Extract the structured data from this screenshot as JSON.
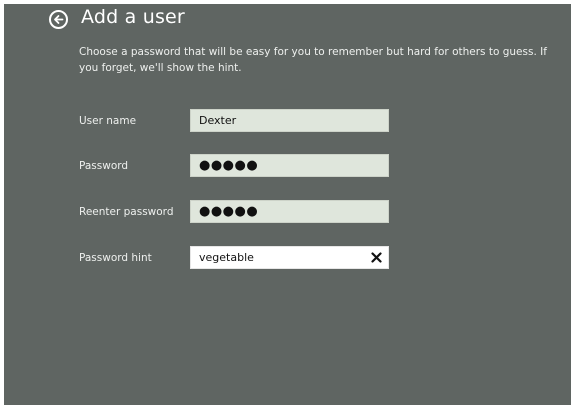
{
  "page": {
    "title": "Add a user",
    "description": "Choose a password that will be easy for you to remember but hard for others to guess. If you forget, we'll show the hint."
  },
  "form": {
    "username": {
      "label": "User name",
      "value": "Dexter"
    },
    "password": {
      "label": "Password",
      "value": "●●●●●"
    },
    "reenter_password": {
      "label": "Reenter password",
      "value": "●●●●●"
    },
    "password_hint": {
      "label": "Password hint",
      "value": "vegetable"
    }
  },
  "icons": {
    "back": "back-arrow-icon",
    "clear": "close-icon"
  },
  "colors": {
    "background": "#5f6562",
    "field_background": "#dfe6dc",
    "active_field_background": "#ffffff"
  }
}
